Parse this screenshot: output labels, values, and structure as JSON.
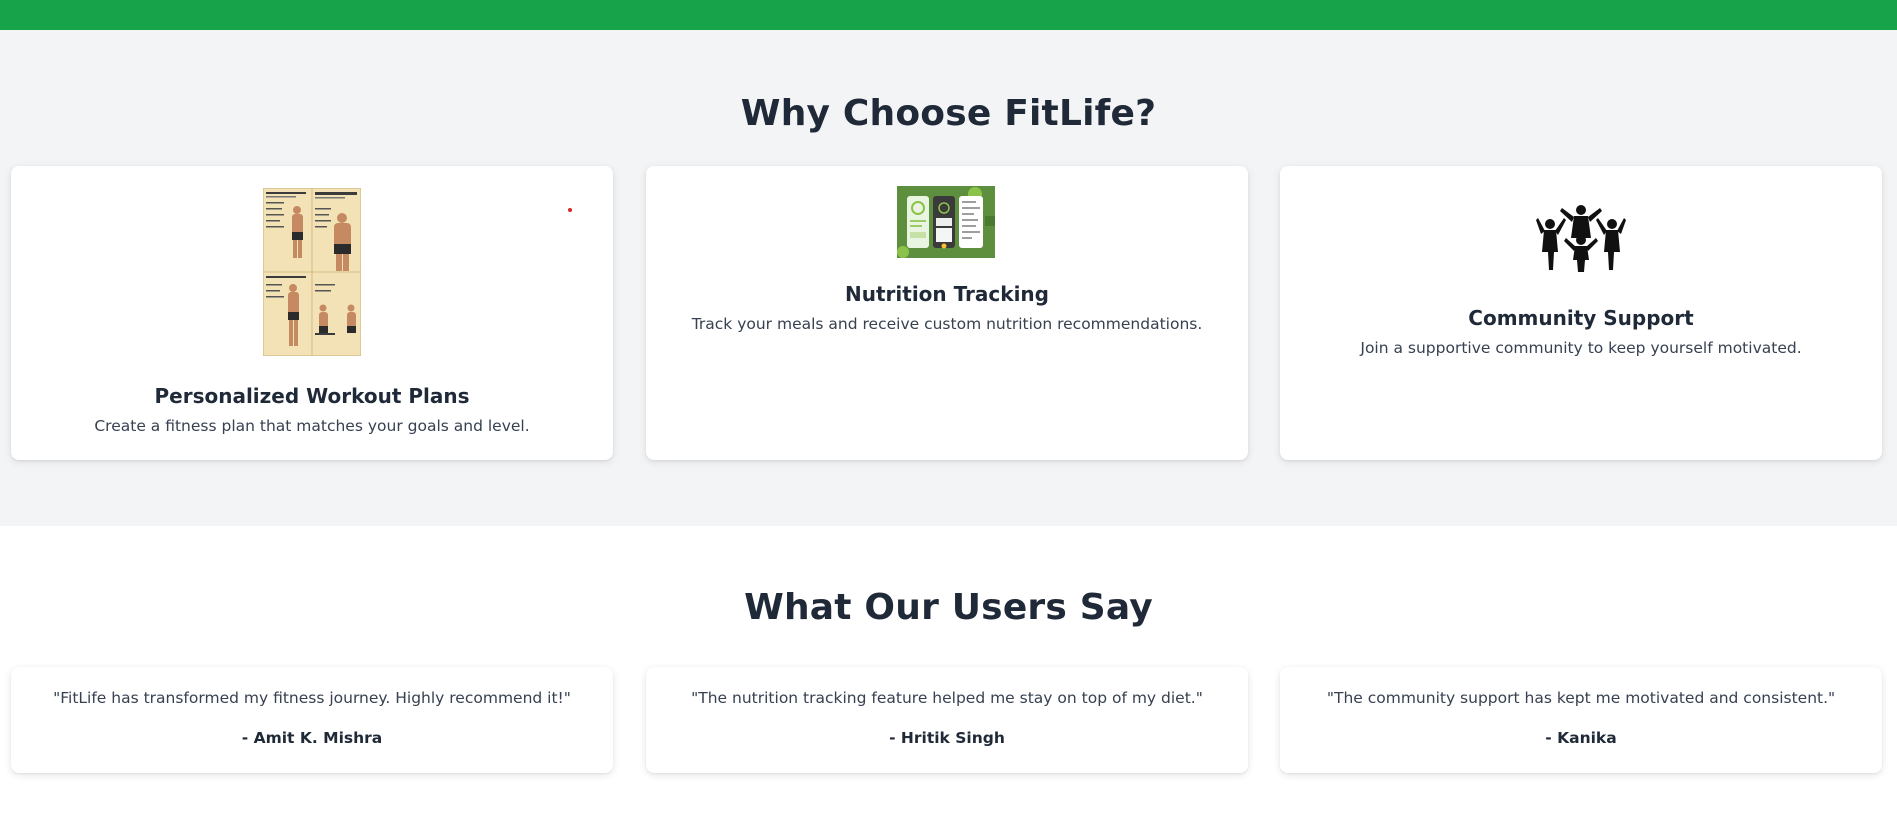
{
  "colors": {
    "topbar": "#16a34a",
    "features_bg": "#f3f4f6",
    "card_bg": "#ffffff",
    "heading": "#1f2937",
    "text": "#374151"
  },
  "features": {
    "title": "Why Choose FitLife?",
    "cards": [
      {
        "image": "workout-plan-poster-image",
        "title": "Personalized Workout Plans",
        "description": "Create a fitness plan that matches your goals and level."
      },
      {
        "image": "nutrition-app-screens-image",
        "title": "Nutrition Tracking",
        "description": "Track your meals and receive custom nutrition recommendations."
      },
      {
        "image": "community-people-icon",
        "title": "Community Support",
        "description": "Join a supportive community to keep yourself motivated."
      }
    ]
  },
  "testimonials": {
    "title": "What Our Users Say",
    "items": [
      {
        "quote": "\"FitLife has transformed my fitness journey. Highly recommend it!\"",
        "author": "- Amit K. Mishra"
      },
      {
        "quote": "\"The nutrition tracking feature helped me stay on top of my diet.\"",
        "author": "- Hritik Singh"
      },
      {
        "quote": "\"The community support has kept me motivated and consistent.\"",
        "author": "- Kanika"
      }
    ]
  }
}
